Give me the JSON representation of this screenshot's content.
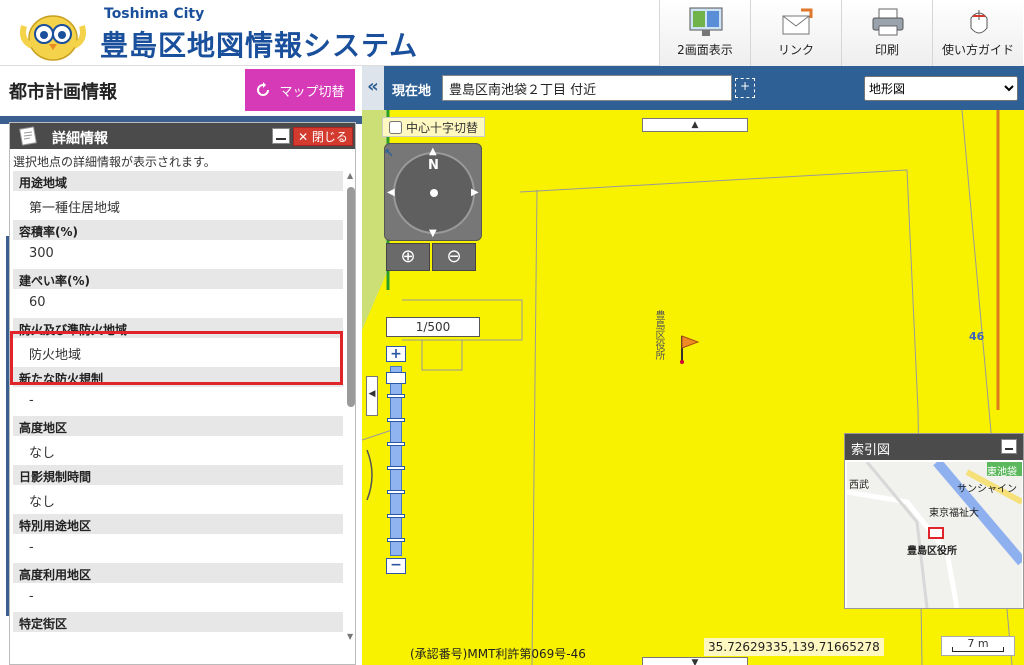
{
  "header": {
    "city_en": "Toshima City",
    "system_title": "豊島区地図情報システム",
    "buttons": [
      "2画面表示",
      "リンク",
      "印刷",
      "使い方ガイド"
    ]
  },
  "left_panel": {
    "title": "都市計画情報",
    "map_switch_label": "マップ切替",
    "detail": {
      "title": "詳細情報",
      "close_label": "✕ 閉じる",
      "description": "選択地点の詳細情報が表示されます。",
      "rows": [
        {
          "label": "用途地域",
          "value": "第一種住居地域"
        },
        {
          "label": "容積率(%)",
          "value": "300"
        },
        {
          "label": "建ぺい率(%)",
          "value": "60"
        },
        {
          "label": "防火及び準防火地域",
          "value": "防火地域"
        },
        {
          "label": "新たな防火規制",
          "value": "-"
        },
        {
          "label": "高度地区",
          "value": "なし"
        },
        {
          "label": "日影規制時間",
          "value": "なし"
        },
        {
          "label": "特別用途地区",
          "value": "-"
        },
        {
          "label": "高度利用地区",
          "value": "-"
        },
        {
          "label": "特定街区",
          "value": ""
        }
      ]
    }
  },
  "map": {
    "collapse_glyph": "«",
    "location_label": "現在地",
    "location_value": "豊島区南池袋２丁目 付近",
    "map_type_selected": "地形図",
    "cross_toggle_label": "中心十字切替",
    "compass_north": "N",
    "scale": "1/500",
    "building_label": "豊島区役所",
    "block_number": "46",
    "index_map": {
      "title": "索引図",
      "labels": [
        "西武",
        "東京福祉大",
        "豊島区役所",
        "東池袋",
        "サンシャイン"
      ]
    },
    "approval": "(承認番号)MMT利許第069号-46",
    "coordinates": "35.72629335,139.71665278",
    "scalebar": "7 m"
  },
  "colors": {
    "brand_blue": "#1a4f9c",
    "map_switch": "#d63ab7",
    "highlight": "#e0242a",
    "map_yellow": "#f8f200",
    "toolbar_blue": "#2e5f95"
  }
}
